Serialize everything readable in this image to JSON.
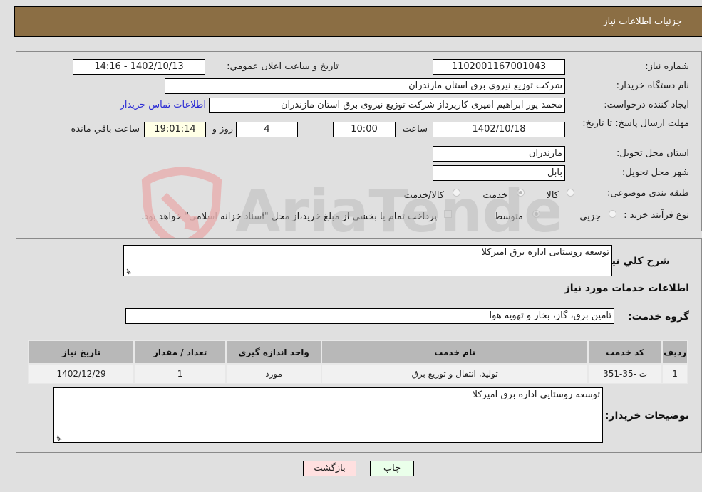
{
  "header": {
    "title": "جزئیات اطلاعات نیاز"
  },
  "fields": {
    "need_number": {
      "label": "شماره نیاز:",
      "value": "1102001167001043"
    },
    "announce_datetime": {
      "label": "تاریخ و ساعت اعلان عمومي:",
      "value": "1402/10/13 - 14:16"
    },
    "buyer_org": {
      "label": "نام دستگاه خریدار:",
      "value": "شرکت توزیع نیروی برق استان مازندران"
    },
    "requester": {
      "label": "ایجاد کننده درخواست:",
      "value": "محمد پور ابراهیم امیری کارپرداز شرکت توزیع نیروی برق استان مازندران",
      "contact_link": "اطلاعات تماس خریدار"
    },
    "deadline": {
      "label": "مهلت ارسال پاسخ: تا تاریخ:",
      "date": "1402/10/18",
      "time_label": "ساعت",
      "time": "10:00",
      "days": "4",
      "days_label": "روز و",
      "remaining": "19:01:14",
      "remaining_label": "ساعت باقي مانده"
    },
    "province": {
      "label": "استان محل تحویل:",
      "value": "مازندران"
    },
    "city": {
      "label": "شهر محل تحویل:",
      "value": "بابل"
    },
    "category": {
      "label": "طبقه بندی موضوعی:",
      "options": [
        "کالا",
        "خدمت",
        "کالا/خدمت"
      ],
      "selected": "خدمت"
    },
    "purchase_type": {
      "label": "نوع فرآیند خرید :",
      "options": [
        "جزيي",
        "متوسط"
      ],
      "selected": "متوسط",
      "treasury_note": "پرداخت تمام یا بخشی از مبلغ خرید،از محل \"اسناد خزانه اسلامی\" خواهد بود."
    }
  },
  "summary": {
    "label": "شرح کلي نياز:",
    "value": "توسعه روستایی اداره برق امیرکلا"
  },
  "services_heading": "اطلاعات خدمات مورد نیاز",
  "service_group": {
    "label": "گروه خدمت:",
    "value": "تامین برق، گاز، بخار و تهویه هوا"
  },
  "table": {
    "headers": [
      "ردیف",
      "کد خدمت",
      "نام خدمت",
      "واحد اندازه گیری",
      "تعداد / مقدار",
      "تاریخ نیاز"
    ],
    "rows": [
      [
        "1",
        "ت -35-351",
        "تولید، انتقال و توزیع برق",
        "مورد",
        "1",
        "1402/12/29"
      ]
    ]
  },
  "buyer_notes": {
    "label": "توضیحات خریدار:",
    "value": "توسعه روستایی اداره برق امیرکلا"
  },
  "buttons": {
    "print": "چاپ",
    "back": "بازگشت"
  },
  "watermark": "AriaTender.neT",
  "colors": {
    "header_bg": "#8b6e44",
    "print_bg": "#eaffea",
    "back_bg": "#ffe0e0",
    "link": "#2a2ad4"
  }
}
